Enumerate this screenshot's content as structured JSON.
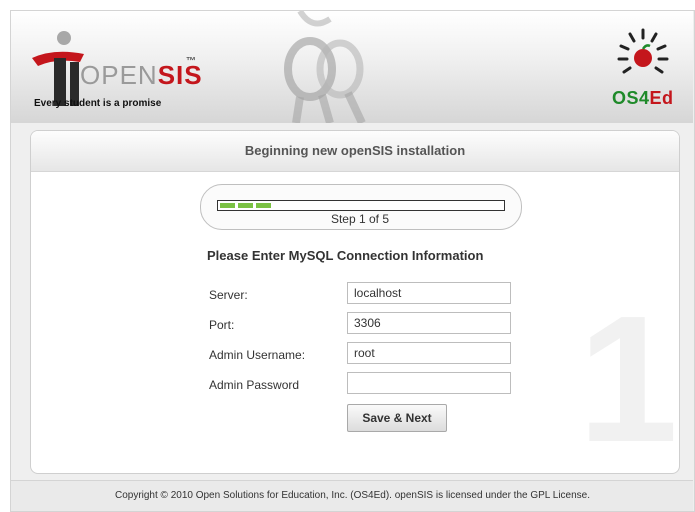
{
  "header": {
    "brand_open": "OPEN",
    "brand_sis": "SIS",
    "brand_tm": "™",
    "tagline": "Every student is a promise",
    "os4ed_prefix": "OS4",
    "os4ed_suffix": "Ed"
  },
  "installer": {
    "title": "Beginning new openSIS installation",
    "step_label": "Step 1 of 5",
    "progress_fraction": 0.2,
    "watermark_number": "1"
  },
  "form": {
    "heading": "Please Enter MySQL Connection Information",
    "fields": [
      {
        "label": "Server:",
        "value": "localhost"
      },
      {
        "label": "Port:",
        "value": "3306"
      },
      {
        "label": "Admin Username:",
        "value": "root"
      },
      {
        "label": "Admin Password",
        "value": ""
      }
    ],
    "save_label": "Save & Next"
  },
  "footer": {
    "copyright": "Copyright © 2010 Open Solutions for Education, Inc. (OS4Ed). openSIS is licensed under the GPL License."
  },
  "colors": {
    "accent_red": "#c4161c",
    "progress_green": "#7ac143",
    "os4ed_green": "#1f8a2a"
  }
}
